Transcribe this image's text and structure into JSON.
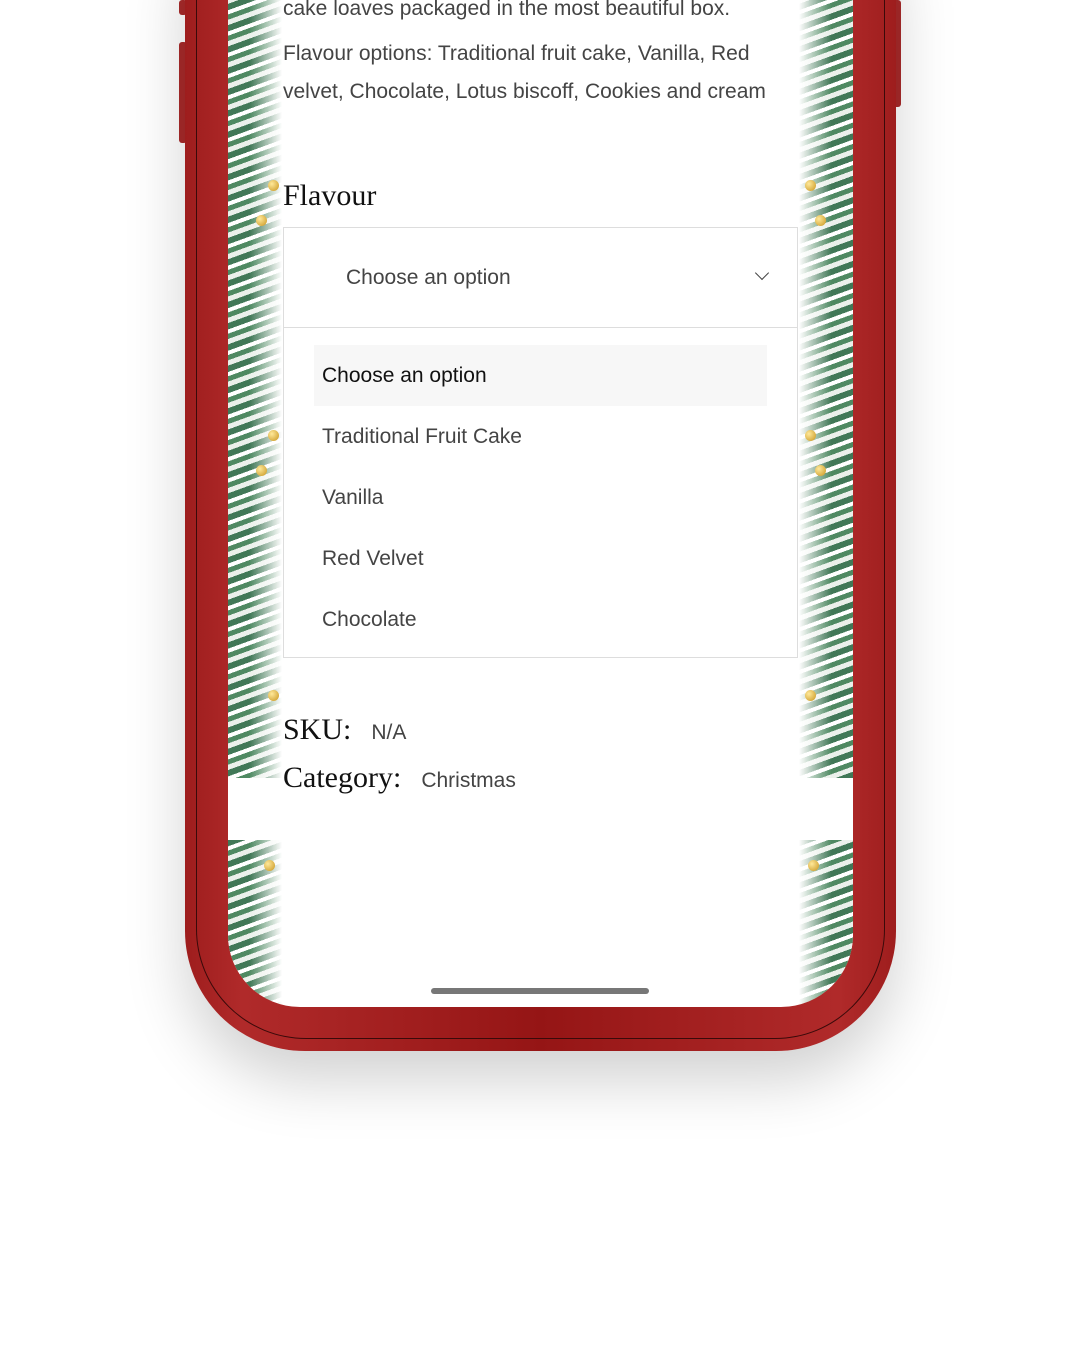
{
  "description": {
    "line1": "cake loaves packaged in the most beautiful box.",
    "line2": "Flavour options: Traditional fruit cake, Vanilla, Red velvet, Chocolate, Lotus biscoff, Cookies and cream"
  },
  "flavour": {
    "label": "Flavour",
    "selected": "Choose an option",
    "options": [
      "Choose an option",
      "Traditional Fruit Cake",
      "Vanilla",
      "Red Velvet",
      "Chocolate"
    ]
  },
  "meta": {
    "sku_label": "SKU:",
    "sku_value": "N/A",
    "category_label": "Category:",
    "category_value": "Christmas"
  },
  "colors": {
    "phone_frame": "#9e1d1d",
    "garland": "#2d6a45",
    "ornament": "#c8941d"
  }
}
